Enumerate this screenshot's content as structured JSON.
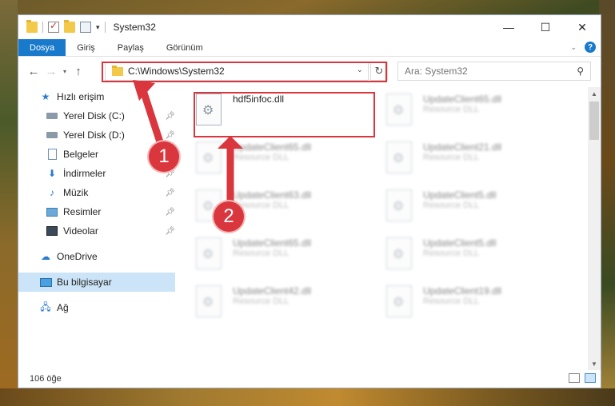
{
  "window": {
    "title": "System32"
  },
  "ribbon": {
    "tabs": [
      "Dosya",
      "Giriş",
      "Paylaş",
      "Görünüm"
    ]
  },
  "address": {
    "path": "C:\\Windows\\System32"
  },
  "search": {
    "placeholder": "Ara: System32"
  },
  "nav": {
    "items": [
      {
        "label": "Hızlı erişim"
      },
      {
        "label": "Yerel Disk (C:)"
      },
      {
        "label": "Yerel Disk (D:)"
      },
      {
        "label": "Belgeler"
      },
      {
        "label": "İndirmeler"
      },
      {
        "label": "Müzik"
      },
      {
        "label": "Resimler"
      },
      {
        "label": "Videolar"
      },
      {
        "label": "OneDrive"
      },
      {
        "label": "Bu bilgisayar"
      },
      {
        "label": "Ağ"
      }
    ]
  },
  "files": {
    "main": {
      "name": "hdf5infoc.dll"
    },
    "blurred": [
      {
        "name": "UpdateClient65.dll",
        "type": "Resource DLL"
      },
      {
        "name": "UpdateClient65.dll",
        "type": "Resource DLL"
      },
      {
        "name": "UpdateClient21.dll",
        "type": "Resource DLL"
      },
      {
        "name": "UpdateClient63.dll",
        "type": "Resource DLL"
      },
      {
        "name": "UpdateClient5.dll",
        "type": "Resource DLL"
      },
      {
        "name": "UpdateClient65.dll",
        "type": "Resource DLL"
      },
      {
        "name": "UpdateClient5.dll",
        "type": "Resource DLL"
      },
      {
        "name": "UpdateClient42.dll",
        "type": "Resource DLL"
      },
      {
        "name": "UpdateClient19.dll",
        "type": "Resource DLL"
      }
    ]
  },
  "status": {
    "count": "106 öğe"
  },
  "callouts": {
    "one": "1",
    "two": "2"
  },
  "colors": {
    "accent": "#1979ca",
    "highlight": "#d9363e",
    "selection": "#cce4f7"
  },
  "icons": [
    "folder-icon",
    "checkmark-icon",
    "properties-icon",
    "back-arrow-icon",
    "forward-arrow-icon",
    "up-arrow-icon",
    "refresh-icon",
    "search-icon",
    "help-icon",
    "pin-icon",
    "star-icon",
    "drive-icon",
    "document-icon",
    "download-icon",
    "music-icon",
    "pictures-icon",
    "videos-icon",
    "cloud-icon",
    "computer-icon",
    "network-icon",
    "dll-file-icon"
  ]
}
